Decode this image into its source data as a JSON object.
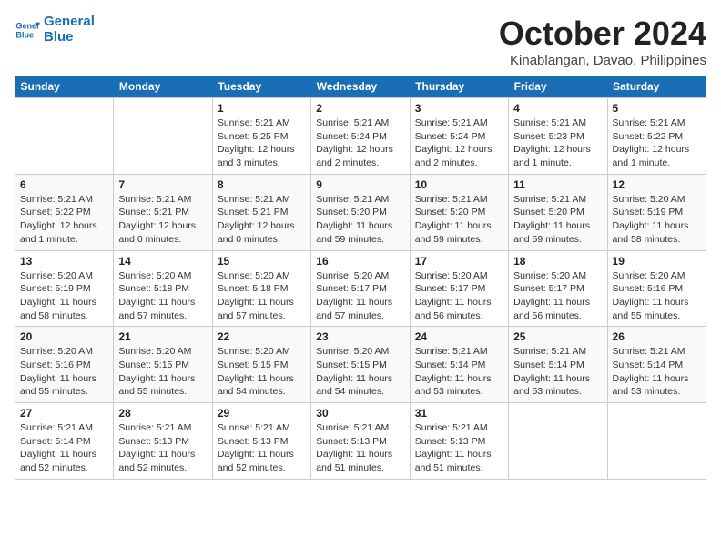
{
  "header": {
    "logo_line1": "General",
    "logo_line2": "Blue",
    "month_title": "October 2024",
    "subtitle": "Kinablangan, Davao, Philippines"
  },
  "weekdays": [
    "Sunday",
    "Monday",
    "Tuesday",
    "Wednesday",
    "Thursday",
    "Friday",
    "Saturday"
  ],
  "weeks": [
    [
      {
        "day": "",
        "info": ""
      },
      {
        "day": "",
        "info": ""
      },
      {
        "day": "1",
        "info": "Sunrise: 5:21 AM\nSunset: 5:25 PM\nDaylight: 12 hours\nand 3 minutes."
      },
      {
        "day": "2",
        "info": "Sunrise: 5:21 AM\nSunset: 5:24 PM\nDaylight: 12 hours\nand 2 minutes."
      },
      {
        "day": "3",
        "info": "Sunrise: 5:21 AM\nSunset: 5:24 PM\nDaylight: 12 hours\nand 2 minutes."
      },
      {
        "day": "4",
        "info": "Sunrise: 5:21 AM\nSunset: 5:23 PM\nDaylight: 12 hours\nand 1 minute."
      },
      {
        "day": "5",
        "info": "Sunrise: 5:21 AM\nSunset: 5:22 PM\nDaylight: 12 hours\nand 1 minute."
      }
    ],
    [
      {
        "day": "6",
        "info": "Sunrise: 5:21 AM\nSunset: 5:22 PM\nDaylight: 12 hours\nand 1 minute."
      },
      {
        "day": "7",
        "info": "Sunrise: 5:21 AM\nSunset: 5:21 PM\nDaylight: 12 hours\nand 0 minutes."
      },
      {
        "day": "8",
        "info": "Sunrise: 5:21 AM\nSunset: 5:21 PM\nDaylight: 12 hours\nand 0 minutes."
      },
      {
        "day": "9",
        "info": "Sunrise: 5:21 AM\nSunset: 5:20 PM\nDaylight: 11 hours\nand 59 minutes."
      },
      {
        "day": "10",
        "info": "Sunrise: 5:21 AM\nSunset: 5:20 PM\nDaylight: 11 hours\nand 59 minutes."
      },
      {
        "day": "11",
        "info": "Sunrise: 5:21 AM\nSunset: 5:20 PM\nDaylight: 11 hours\nand 59 minutes."
      },
      {
        "day": "12",
        "info": "Sunrise: 5:20 AM\nSunset: 5:19 PM\nDaylight: 11 hours\nand 58 minutes."
      }
    ],
    [
      {
        "day": "13",
        "info": "Sunrise: 5:20 AM\nSunset: 5:19 PM\nDaylight: 11 hours\nand 58 minutes."
      },
      {
        "day": "14",
        "info": "Sunrise: 5:20 AM\nSunset: 5:18 PM\nDaylight: 11 hours\nand 57 minutes."
      },
      {
        "day": "15",
        "info": "Sunrise: 5:20 AM\nSunset: 5:18 PM\nDaylight: 11 hours\nand 57 minutes."
      },
      {
        "day": "16",
        "info": "Sunrise: 5:20 AM\nSunset: 5:17 PM\nDaylight: 11 hours\nand 57 minutes."
      },
      {
        "day": "17",
        "info": "Sunrise: 5:20 AM\nSunset: 5:17 PM\nDaylight: 11 hours\nand 56 minutes."
      },
      {
        "day": "18",
        "info": "Sunrise: 5:20 AM\nSunset: 5:17 PM\nDaylight: 11 hours\nand 56 minutes."
      },
      {
        "day": "19",
        "info": "Sunrise: 5:20 AM\nSunset: 5:16 PM\nDaylight: 11 hours\nand 55 minutes."
      }
    ],
    [
      {
        "day": "20",
        "info": "Sunrise: 5:20 AM\nSunset: 5:16 PM\nDaylight: 11 hours\nand 55 minutes."
      },
      {
        "day": "21",
        "info": "Sunrise: 5:20 AM\nSunset: 5:15 PM\nDaylight: 11 hours\nand 55 minutes."
      },
      {
        "day": "22",
        "info": "Sunrise: 5:20 AM\nSunset: 5:15 PM\nDaylight: 11 hours\nand 54 minutes."
      },
      {
        "day": "23",
        "info": "Sunrise: 5:20 AM\nSunset: 5:15 PM\nDaylight: 11 hours\nand 54 minutes."
      },
      {
        "day": "24",
        "info": "Sunrise: 5:21 AM\nSunset: 5:14 PM\nDaylight: 11 hours\nand 53 minutes."
      },
      {
        "day": "25",
        "info": "Sunrise: 5:21 AM\nSunset: 5:14 PM\nDaylight: 11 hours\nand 53 minutes."
      },
      {
        "day": "26",
        "info": "Sunrise: 5:21 AM\nSunset: 5:14 PM\nDaylight: 11 hours\nand 53 minutes."
      }
    ],
    [
      {
        "day": "27",
        "info": "Sunrise: 5:21 AM\nSunset: 5:14 PM\nDaylight: 11 hours\nand 52 minutes."
      },
      {
        "day": "28",
        "info": "Sunrise: 5:21 AM\nSunset: 5:13 PM\nDaylight: 11 hours\nand 52 minutes."
      },
      {
        "day": "29",
        "info": "Sunrise: 5:21 AM\nSunset: 5:13 PM\nDaylight: 11 hours\nand 52 minutes."
      },
      {
        "day": "30",
        "info": "Sunrise: 5:21 AM\nSunset: 5:13 PM\nDaylight: 11 hours\nand 51 minutes."
      },
      {
        "day": "31",
        "info": "Sunrise: 5:21 AM\nSunset: 5:13 PM\nDaylight: 11 hours\nand 51 minutes."
      },
      {
        "day": "",
        "info": ""
      },
      {
        "day": "",
        "info": ""
      }
    ]
  ]
}
